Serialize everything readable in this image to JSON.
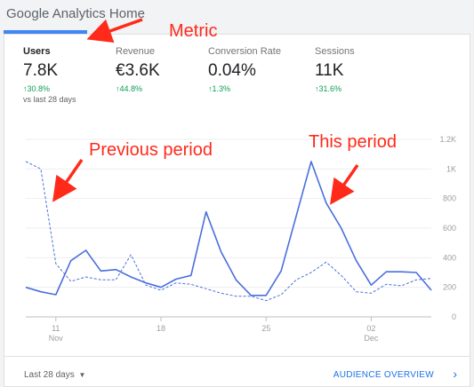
{
  "header": {
    "title": "Google Analytics Home"
  },
  "metrics": [
    {
      "label": "Users",
      "value": "7.8K",
      "change": "↑30.8%",
      "compare": "vs last 28 days",
      "selected": true
    },
    {
      "label": "Revenue",
      "value": "€3.6K",
      "change": "↑44.8%"
    },
    {
      "label": "Conversion Rate",
      "value": "0.04%",
      "change": "↑1.3%"
    },
    {
      "label": "Sessions",
      "value": "11K",
      "change": "↑31.6%"
    }
  ],
  "chart_data": {
    "type": "line",
    "y_ticks": [
      {
        "label": "1.2K",
        "value": 1200
      },
      {
        "label": "1K",
        "value": 1000
      },
      {
        "label": "800",
        "value": 800
      },
      {
        "label": "600",
        "value": 600
      },
      {
        "label": "400",
        "value": 400
      },
      {
        "label": "200",
        "value": 200
      },
      {
        "label": "0",
        "value": 0
      }
    ],
    "ylim": [
      0,
      1200
    ],
    "x_days": 28,
    "x_ticks": [
      {
        "label": "11",
        "sub": "Nov",
        "day": 2
      },
      {
        "label": "18",
        "day": 9
      },
      {
        "label": "25",
        "day": 16
      },
      {
        "label": "02",
        "sub": "Dec",
        "day": 23
      }
    ],
    "grid": true,
    "series": [
      {
        "style": "solid",
        "color": "#4a6fdc",
        "values": [
          200,
          170,
          150,
          380,
          450,
          310,
          320,
          270,
          230,
          200,
          255,
          280,
          710,
          440,
          250,
          145,
          145,
          310,
          680,
          1050,
          770,
          600,
          380,
          215,
          305,
          305,
          300,
          180
        ]
      },
      {
        "style": "dashed",
        "color": "#4a6fdc",
        "values": [
          1050,
          1000,
          360,
          240,
          270,
          250,
          250,
          420,
          215,
          180,
          230,
          220,
          190,
          160,
          140,
          140,
          110,
          150,
          250,
          300,
          370,
          280,
          170,
          160,
          220,
          210,
          250,
          260
        ]
      }
    ]
  },
  "footer": {
    "date_range": "Last 28 days",
    "caret": "▼",
    "audience_link": "AUDIENCE OVERVIEW",
    "chevron": "›"
  },
  "annotations": {
    "metric": "Metric",
    "previous_period": "Previous period",
    "this_period": "This period"
  },
  "colors": {
    "accent": "#4285f4",
    "line": "#4a6fdc",
    "positive": "#0f9d58",
    "annotation": "#ff2a1a",
    "link": "#1a73e8"
  }
}
